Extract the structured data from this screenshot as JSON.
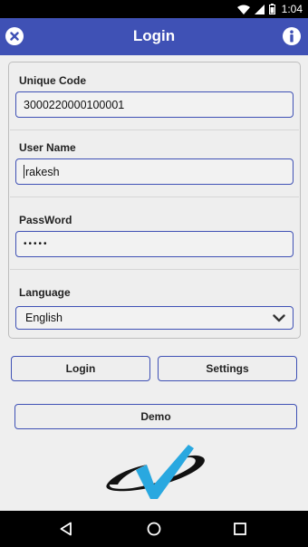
{
  "status_bar": {
    "time": "1:04",
    "icons": [
      "wifi-icon",
      "signal-icon",
      "battery-icon"
    ]
  },
  "app_bar": {
    "title": "Login",
    "left_icon": "close-icon",
    "right_icon": "info-icon",
    "color": "#3f51b5"
  },
  "form": {
    "unique_code": {
      "label": "Unique Code",
      "value": "3000220000100001"
    },
    "user_name": {
      "label": "User Name",
      "value": "rakesh"
    },
    "password": {
      "label": "PassWord",
      "value": "•••••"
    },
    "language": {
      "label": "Language",
      "selected": "English"
    }
  },
  "buttons": {
    "login": "Login",
    "settings": "Settings",
    "demo": "Demo"
  },
  "colors": {
    "accent": "#3f51b5",
    "logo_check": "#29a8e0"
  }
}
